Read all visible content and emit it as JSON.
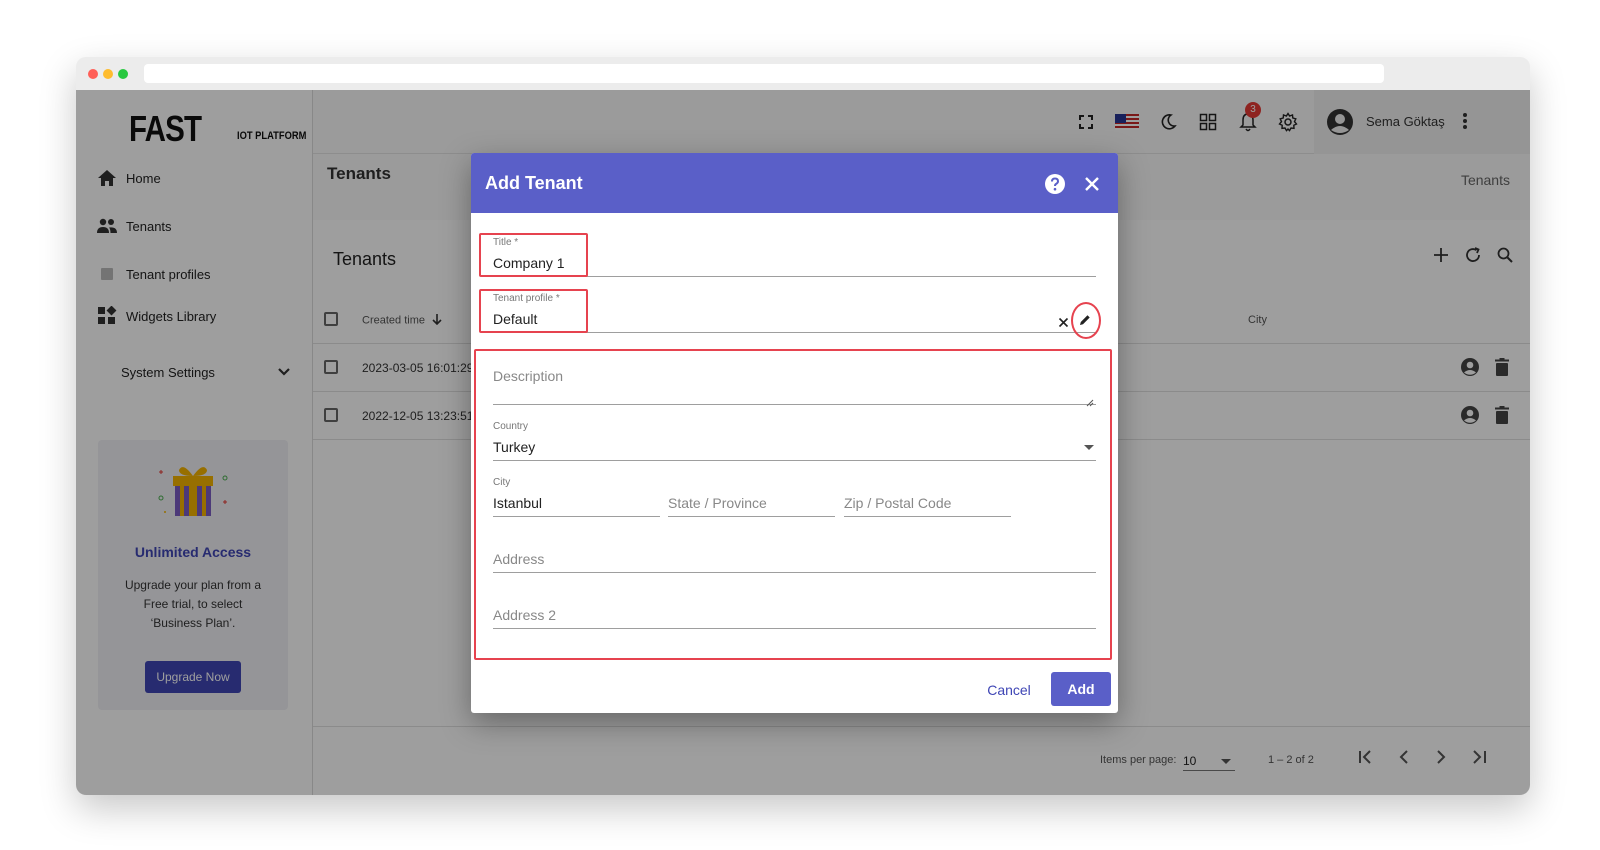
{
  "app": {
    "logo_main": "FAST",
    "logo_sub": "IOT PLATFORM"
  },
  "sidebar": {
    "items": [
      {
        "label": "Home",
        "icon": "home-icon"
      },
      {
        "label": "Tenants",
        "icon": "people-icon"
      },
      {
        "label": "Tenant profiles",
        "icon": "profile-card-icon"
      },
      {
        "label": "Widgets Library",
        "icon": "widgets-icon"
      }
    ],
    "system_settings": "System Settings",
    "promo": {
      "title": "Unlimited Access",
      "text": "Upgrade your plan from a Free trial, to select ‘Business Plan’.",
      "button": "Upgrade Now"
    }
  },
  "header": {
    "notification_count": "3",
    "username": "Sema Göktaş"
  },
  "page": {
    "title": "Tenants",
    "breadcrumb": "Tenants"
  },
  "table": {
    "title": "Tenants",
    "columns": {
      "created_time": "Created time",
      "city": "City"
    },
    "rows": [
      {
        "created_time": "2023-03-05 16:01:29"
      },
      {
        "created_time": "2022-12-05 13:23:51"
      }
    ]
  },
  "paginator": {
    "items_per_page_label": "Items per page:",
    "items_per_page": "10",
    "range": "1 – 2 of 2"
  },
  "dialog": {
    "title": "Add Tenant",
    "fields": {
      "title_label": "Title *",
      "title_value": "Company 1",
      "profile_label": "Tenant profile *",
      "profile_value": "Default",
      "description_placeholder": "Description",
      "country_label": "Country",
      "country_value": "Turkey",
      "city_label": "City",
      "city_value": "Istanbul",
      "state_placeholder": "State / Province",
      "zip_placeholder": "Zip / Postal Code",
      "address_placeholder": "Address",
      "address2_placeholder": "Address 2"
    },
    "cancel_label": "Cancel",
    "add_label": "Add"
  },
  "colors": {
    "primary": "#5a5fc8",
    "accent_dark": "#3f46b5",
    "highlight": "#e6434f",
    "badge": "#e53935"
  }
}
